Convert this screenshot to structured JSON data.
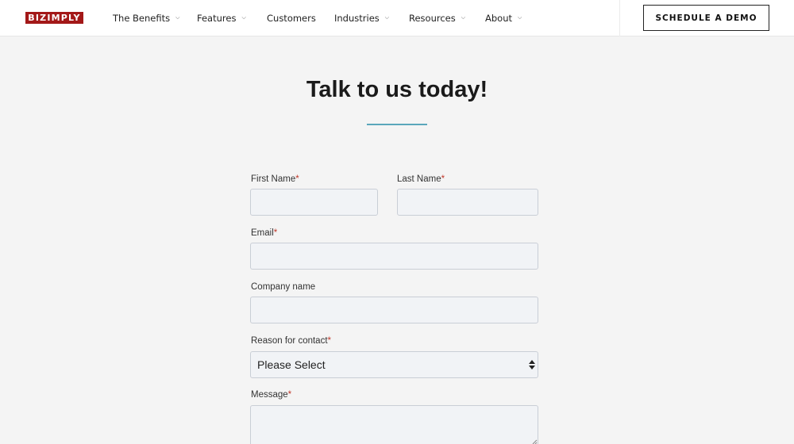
{
  "header": {
    "logo_text": "BIZIMPLY",
    "nav": [
      {
        "label": "The Benefits",
        "dropdown": true
      },
      {
        "label": "Features",
        "dropdown": true
      },
      {
        "label": "Customers",
        "dropdown": false
      },
      {
        "label": "Industries",
        "dropdown": true
      },
      {
        "label": "Resources",
        "dropdown": true
      },
      {
        "label": "About",
        "dropdown": true
      }
    ],
    "cta": "SCHEDULE A DEMO"
  },
  "page": {
    "title": "Talk to us today!"
  },
  "form": {
    "first_name_label": "First Name",
    "last_name_label": "Last Name",
    "email_label": "Email",
    "company_label": "Company name",
    "reason_label": "Reason for contact",
    "reason_value": "Please Select",
    "message_label": "Message",
    "required_mark": "*"
  },
  "colors": {
    "brand": "#a31818",
    "accent_rule": "#5aa7bb",
    "required": "#c0392b",
    "page_bg": "#f4f4f4"
  }
}
